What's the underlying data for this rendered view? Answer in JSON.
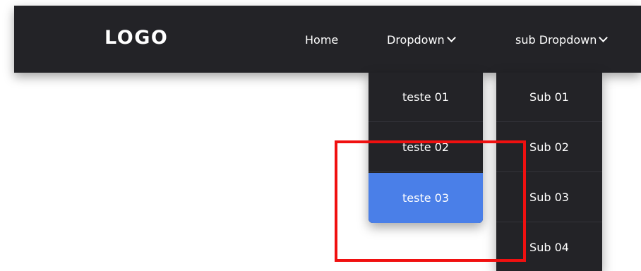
{
  "navbar": {
    "logo": "LOGO",
    "links": [
      {
        "label": "Home"
      },
      {
        "label": "Dropdown"
      },
      {
        "label": "sub Dropdown"
      }
    ]
  },
  "dropdown_menu": {
    "items": [
      {
        "label": "teste 01"
      },
      {
        "label": "teste 02"
      },
      {
        "label": "teste 03"
      }
    ],
    "active_item": "teste 03"
  },
  "sub_dropdown_menu": {
    "items": [
      {
        "label": "Sub 01"
      },
      {
        "label": "Sub 02"
      },
      {
        "label": "Sub 03"
      },
      {
        "label": "Sub 04"
      }
    ]
  },
  "colors": {
    "navbar_background": "#232327",
    "active_item": "#4a7fe8",
    "annotation_box": "#f01010"
  },
  "icons": {
    "dropdown_chevron": "chevron-down-icon"
  }
}
